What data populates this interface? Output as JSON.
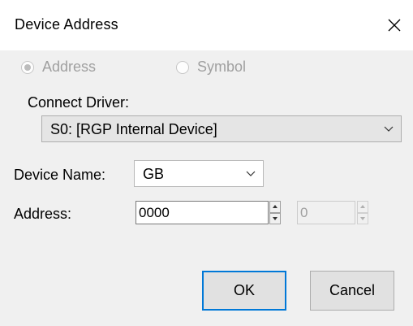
{
  "dialog": {
    "title": "Device Address"
  },
  "mode": {
    "address_label": "Address",
    "symbol_label": "Symbol",
    "selected": "Address"
  },
  "connect_driver": {
    "label": "Connect Driver:",
    "value": "S0: [RGP Internal Device]"
  },
  "device": {
    "label": "Device Name:",
    "value": "GB"
  },
  "address": {
    "label": "Address:",
    "value": "0000",
    "bit_value": "0"
  },
  "buttons": {
    "ok": "OK",
    "cancel": "Cancel"
  },
  "colors": {
    "default_button_border": "#0078d7",
    "disabled_text": "#a0a0a0",
    "dialog_background": "#f0f0f0"
  }
}
